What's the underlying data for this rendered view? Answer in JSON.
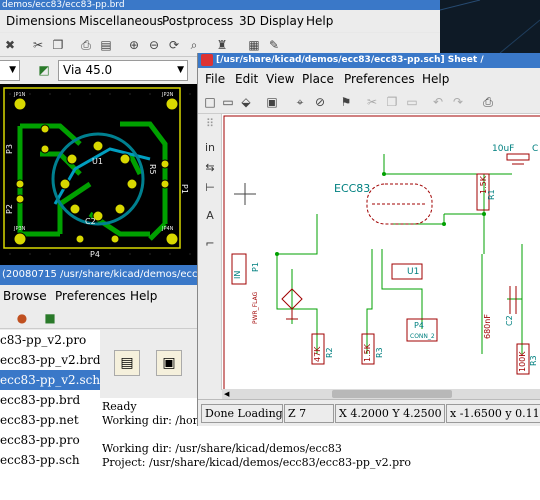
{
  "pcb": {
    "title": "demos/ecc83/ecc83-pp.brd",
    "menu": [
      "Dimensions",
      "Miscellaneous",
      "Postprocess",
      "3D Display",
      "Help"
    ],
    "via_label": "Via 45.0",
    "status": "(20080715 /usr/share/kicad/demos/ecc83/e",
    "labels": {
      "p3": "P3",
      "p2": "P2",
      "p4": "P4",
      "p1": "P1",
      "u1": "U1",
      "c2": "C2",
      "r5": "R5",
      "jp1": "JP1N",
      "jp2": "JP2N",
      "jp3": "JP3N",
      "jp4": "JP4N"
    }
  },
  "manager": {
    "menu": [
      "Browse",
      "Preferences",
      "Help"
    ],
    "tree": [
      "c83-pp_v2.pro",
      "ecc83-pp_v2.brd",
      "ecc83-pp_v2.sch",
      "ecc83-pp.brd",
      "ecc83-pp.net",
      "ecc83-pp.pro",
      "ecc83-pp.sch"
    ],
    "selected_index": 2,
    "log": [
      "Ready",
      "Working dir: /hor",
      "",
      "Working dir: /usr/share/kicad/demos/ecc83",
      "Project: /usr/share/kicad/demos/ecc83/ecc83-pp_v2.pro"
    ]
  },
  "eeschema": {
    "title": "[/usr/share/kicad/demos/ecc83/ecc83-pp.sch]  Sheet /",
    "menu": [
      "File",
      "Edit",
      "View",
      "Place",
      "Preferences",
      "Help"
    ],
    "status": {
      "loading": "Done Loading",
      "zoom": "Z 7",
      "xy": "X 4.2000  Y 4.2500",
      "dxy": "x -1.6500  y 0.117"
    },
    "labels": {
      "ecc83": "ECC83",
      "r1": "R1",
      "r1v": "1.5K",
      "c1": "10uF",
      "c1l": "C",
      "in": "IN",
      "p1": "P1",
      "pwr": "PWR_FLAG",
      "u1": "U1",
      "p4": "P4",
      "conn": "CONN_2",
      "r2v": "47K",
      "r2": "R2",
      "r3v": "1.5K",
      "r3": "R3",
      "c2v": "680nF",
      "c2": "C2",
      "r4v": "100K",
      "r4": "R3"
    }
  },
  "colors": {
    "titlebar": "#3a78c8",
    "schematic_wire": "#00a000",
    "schematic_part": "#a00000",
    "pcb_copper": "#d8d800",
    "pcb_green": "#00a000"
  }
}
